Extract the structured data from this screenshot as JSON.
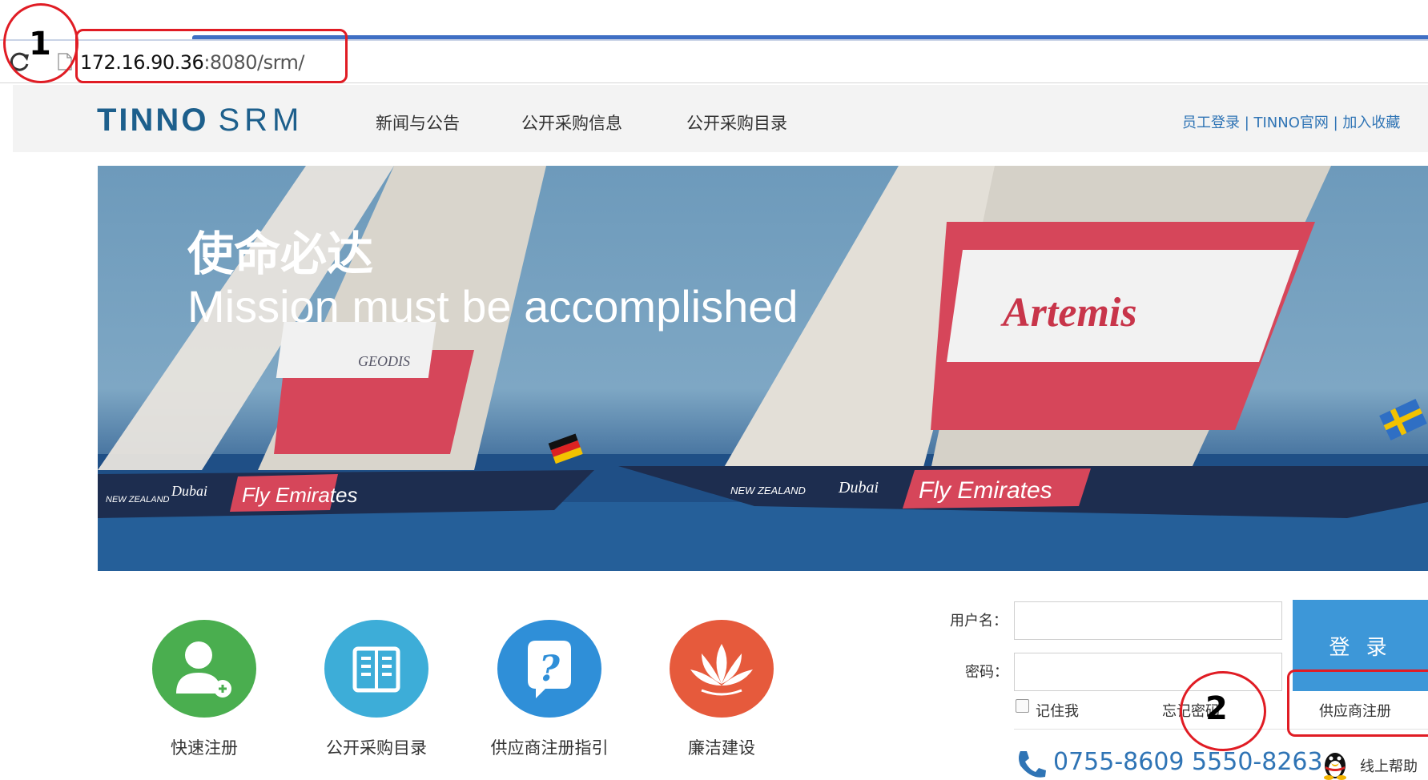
{
  "browser": {
    "url_host": "172.16.90.36",
    "url_rest": ":8080/srm/"
  },
  "header": {
    "logo_main": "TINNO",
    "logo_sub": "SRM",
    "nav": [
      "新闻与公告",
      "公开采购信息",
      "公开采购目录"
    ],
    "top_links": "员工登录 | TINNO官网 | 加入收藏"
  },
  "banner": {
    "title": "使命必达",
    "subtitle": "Mission must be accomplished",
    "sail_text": "Artemis",
    "hull_text": "Fly Emirates",
    "hull_text2": "Fly Emirates",
    "geodis": "GEODIS",
    "nz": "NEW ZEALAND",
    "nz2": "NEW ZEALAND",
    "dubai": "Dubai",
    "dubai2": "Dubai"
  },
  "quick_links": [
    {
      "label": "快速注册",
      "icon": "add-user-icon",
      "color": "#4aae4f"
    },
    {
      "label": "公开采购目录",
      "icon": "book-icon",
      "color": "#3dadd8"
    },
    {
      "label": "供应商注册指引",
      "icon": "question-icon",
      "color": "#2f8fd8"
    },
    {
      "label": "廉洁建设",
      "icon": "lotus-icon",
      "color": "#e65a3c"
    }
  ],
  "login": {
    "username_label": "用户名：",
    "password_label": "密码：",
    "login_button": "登 录",
    "remember_label": "记住我",
    "forgot_label": "忘记密码",
    "register_label": "供应商注册",
    "phone": "0755-8609 5550-8263",
    "help_label": "线上帮助"
  },
  "annotations": [
    "1",
    "2"
  ]
}
